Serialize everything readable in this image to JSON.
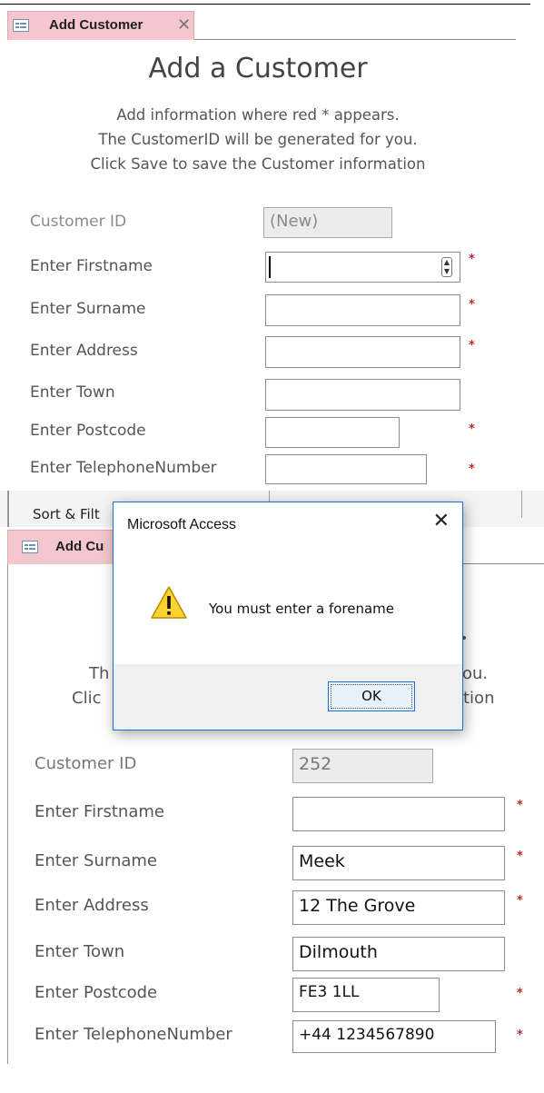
{
  "top_form": {
    "tab_label": "Add Customer",
    "title": "Add a Customer",
    "instructions": [
      "Add information where red * appears.",
      "The CustomerID will be generated for you.",
      "Click Save to save the Customer information"
    ],
    "customer_id_label": "Customer ID",
    "customer_id_value": "(New)",
    "firstname_label": "Enter Firstname",
    "firstname_value": "",
    "surname_label": "Enter Surname",
    "surname_value": "",
    "address_label": "Enter Address",
    "address_value": "",
    "town_label": "Enter Town",
    "town_value": "",
    "postcode_label": "Enter Postcode",
    "postcode_value": "",
    "telephone_label": "Enter TelephoneNumber",
    "telephone_value": "",
    "required_marker": "*"
  },
  "ribbon": {
    "group_label": "Sort & Filt"
  },
  "bottom_form": {
    "tab_label": "Add Cu",
    "instr_line2_left": "Th",
    "instr_line2_right": "ou.",
    "instr_line3_left": "Clic",
    "instr_line3_right": "tion",
    "customer_id_label": "Customer ID",
    "customer_id_value": "252",
    "firstname_label": "Enter Firstname",
    "firstname_value": "",
    "surname_label": "Enter Surname",
    "surname_value": "Meek",
    "address_label": "Enter Address",
    "address_value": "12 The Grove",
    "town_label": "Enter Town",
    "town_value": "Dilmouth",
    "postcode_label": "Enter Postcode",
    "postcode_value": "FE3 1LL",
    "telephone_label": "Enter TelephoneNumber",
    "telephone_value": "+44 1234567890",
    "required_marker": "*"
  },
  "dialog": {
    "title": "Microsoft Access",
    "close_glyph": "✕",
    "message": "You must enter a forename",
    "ok_label": "OK",
    "icon": "warning-icon"
  },
  "colors": {
    "tab_bg": "#f3c7cd",
    "required_star": "#c0262d",
    "dialog_border": "#1a6fd6",
    "warning_yellow": "#fcd22e"
  }
}
